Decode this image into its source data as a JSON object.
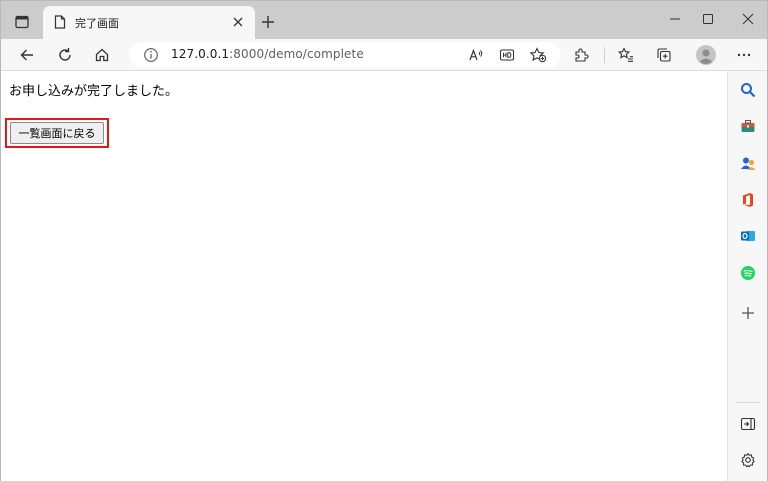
{
  "tab": {
    "title": "完了画面"
  },
  "address": {
    "host": "127.0.0.1",
    "rest": ":8000/demo/complete"
  },
  "page": {
    "message": "お申し込みが完了しました。",
    "back_button_label": "一覧画面に戻る"
  },
  "colors": {
    "highlight": "#e0191b",
    "search": "#1f63d8",
    "tools": "#e0582e",
    "office": "#e64a19",
    "outlook": "#0f6cbd",
    "spotify": "#1ed760"
  }
}
